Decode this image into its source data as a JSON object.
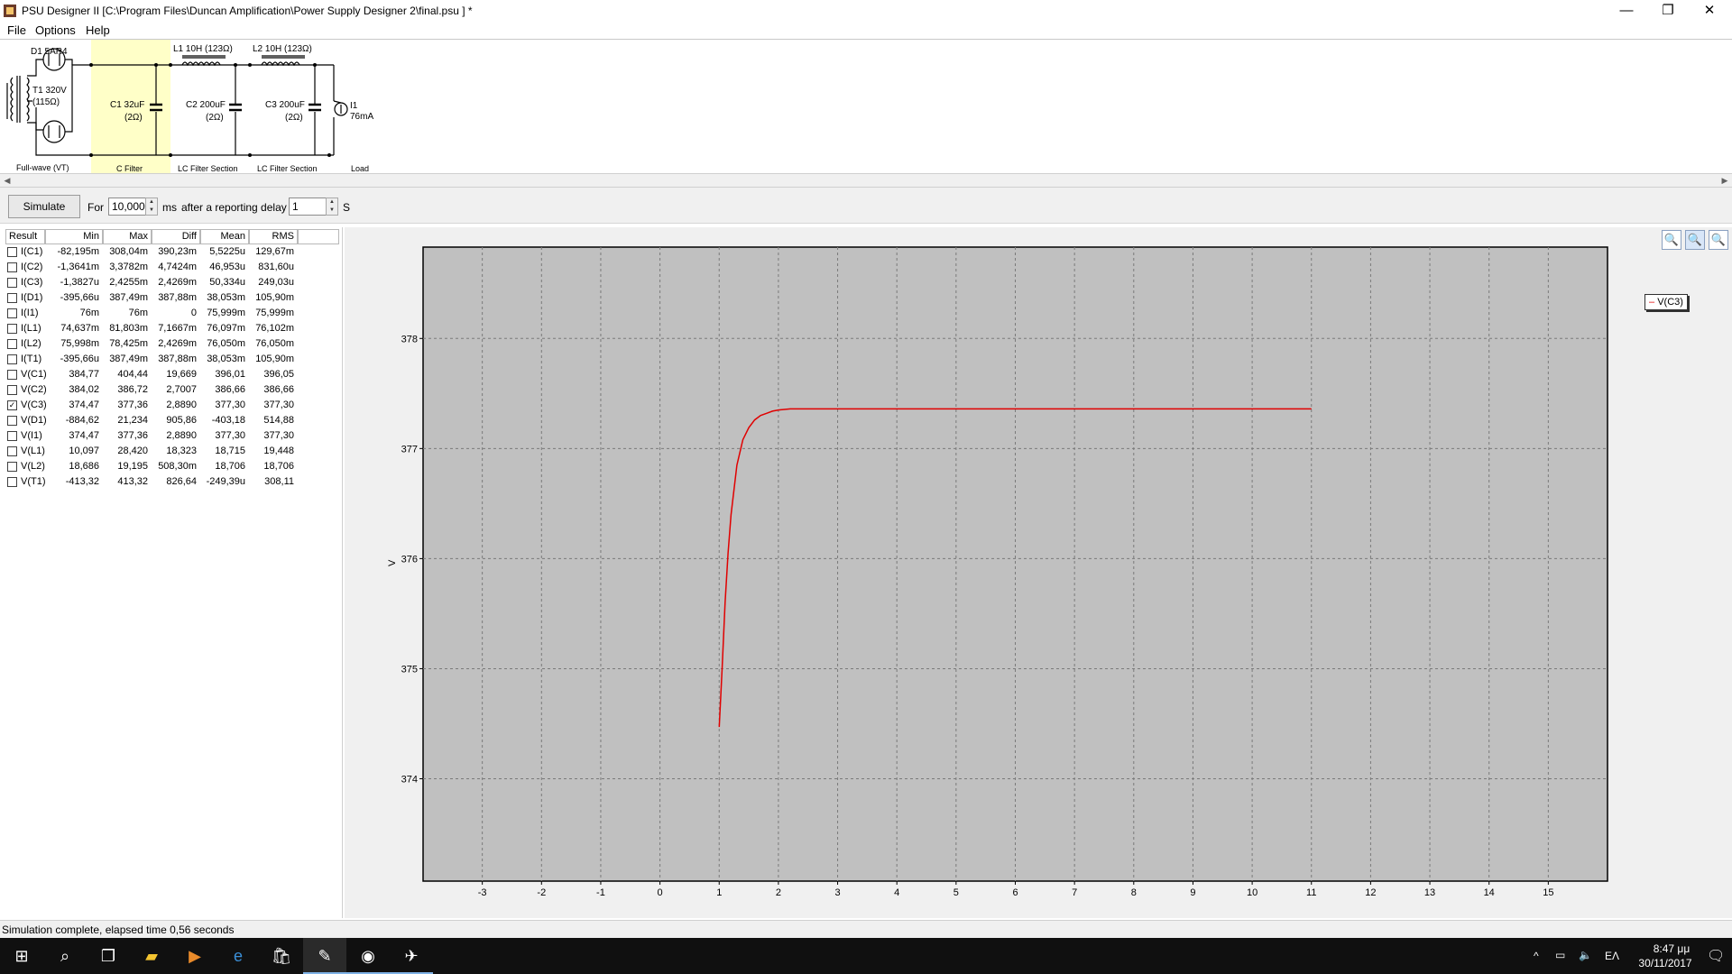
{
  "window": {
    "title": "PSU Designer II  [C:\\Program Files\\Duncan Amplification\\Power Supply Designer 2\\final.psu ] *",
    "minimize": "—",
    "maximize": "❐",
    "close": "✕"
  },
  "menu": [
    "File",
    "Options",
    "Help"
  ],
  "schematic": {
    "d1": "D1 5AR4",
    "t1": "T1 320V",
    "t1_r": "(115Ω)",
    "c1": "C1 32uF",
    "c1_r": "(2Ω)",
    "l1": "L1 10H (123Ω)",
    "c2": "C2 200uF",
    "c2_r": "(2Ω)",
    "l2": "L2 10H (123Ω)",
    "c3": "C3 200uF",
    "c3_r": "(2Ω)",
    "i1": "I1",
    "i1_val": "76mA",
    "sections": [
      "Full-wave (VT)",
      "C Filter",
      "LC Filter Section",
      "LC Filter Section",
      "Load"
    ]
  },
  "toolbar": {
    "simulate": "Simulate",
    "for_label": "For",
    "duration": "10,000",
    "ms_label": "ms",
    "delay_label": "after a reporting delay of",
    "delay": "1",
    "s_label": "S"
  },
  "results": {
    "headers": [
      "Result",
      "Min",
      "Max",
      "Diff",
      "Mean",
      "RMS"
    ],
    "rows": [
      {
        "name": "I(C1)",
        "checked": false,
        "min": "-82,195m",
        "max": "308,04m",
        "diff": "390,23m",
        "mean": "5,5225u",
        "rms": "129,67m"
      },
      {
        "name": "I(C2)",
        "checked": false,
        "min": "-1,3641m",
        "max": "3,3782m",
        "diff": "4,7424m",
        "mean": "46,953u",
        "rms": "831,60u"
      },
      {
        "name": "I(C3)",
        "checked": false,
        "min": "-1,3827u",
        "max": "2,4255m",
        "diff": "2,4269m",
        "mean": "50,334u",
        "rms": "249,03u"
      },
      {
        "name": "I(D1)",
        "checked": false,
        "min": "-395,66u",
        "max": "387,49m",
        "diff": "387,88m",
        "mean": "38,053m",
        "rms": "105,90m"
      },
      {
        "name": "I(I1)",
        "checked": false,
        "min": "76m",
        "max": "76m",
        "diff": "0",
        "mean": "75,999m",
        "rms": "75,999m"
      },
      {
        "name": "I(L1)",
        "checked": false,
        "min": "74,637m",
        "max": "81,803m",
        "diff": "7,1667m",
        "mean": "76,097m",
        "rms": "76,102m"
      },
      {
        "name": "I(L2)",
        "checked": false,
        "min": "75,998m",
        "max": "78,425m",
        "diff": "2,4269m",
        "mean": "76,050m",
        "rms": "76,050m"
      },
      {
        "name": "I(T1)",
        "checked": false,
        "min": "-395,66u",
        "max": "387,49m",
        "diff": "387,88m",
        "mean": "38,053m",
        "rms": "105,90m"
      },
      {
        "name": "V(C1)",
        "checked": false,
        "min": "384,77",
        "max": "404,44",
        "diff": "19,669",
        "mean": "396,01",
        "rms": "396,05"
      },
      {
        "name": "V(C2)",
        "checked": false,
        "min": "384,02",
        "max": "386,72",
        "diff": "2,7007",
        "mean": "386,66",
        "rms": "386,66"
      },
      {
        "name": "V(C3)",
        "checked": true,
        "min": "374,47",
        "max": "377,36",
        "diff": "2,8890",
        "mean": "377,30",
        "rms": "377,30"
      },
      {
        "name": "V(D1)",
        "checked": false,
        "min": "-884,62",
        "max": "21,234",
        "diff": "905,86",
        "mean": "-403,18",
        "rms": "514,88"
      },
      {
        "name": "V(I1)",
        "checked": false,
        "min": "374,47",
        "max": "377,36",
        "diff": "2,8890",
        "mean": "377,30",
        "rms": "377,30"
      },
      {
        "name": "V(L1)",
        "checked": false,
        "min": "10,097",
        "max": "28,420",
        "diff": "18,323",
        "mean": "18,715",
        "rms": "19,448"
      },
      {
        "name": "V(L2)",
        "checked": false,
        "min": "18,686",
        "max": "19,195",
        "diff": "508,30m",
        "mean": "18,706",
        "rms": "18,706"
      },
      {
        "name": "V(T1)",
        "checked": false,
        "min": "-413,32",
        "max": "413,32",
        "diff": "826,64",
        "mean": "-249,39u",
        "rms": "308,11"
      }
    ]
  },
  "chart_data": {
    "type": "line",
    "ylabel": "V",
    "xlim": [
      -4,
      16
    ],
    "ylim": [
      373.07,
      378.83
    ],
    "xticks": [
      -3,
      -2,
      -1,
      0,
      1,
      2,
      3,
      4,
      5,
      6,
      7,
      8,
      9,
      10,
      11,
      12,
      13,
      14,
      15
    ],
    "yticks": [
      374,
      375,
      376,
      377,
      378
    ],
    "grid": true,
    "legend_position": "top-right",
    "series": [
      {
        "name": "V(C3)",
        "color": "#e00000",
        "x": [
          1.0,
          1.05,
          1.1,
          1.15,
          1.2,
          1.3,
          1.4,
          1.5,
          1.6,
          1.7,
          1.8,
          1.9,
          2.0,
          2.2,
          2.5,
          3.0,
          4.0,
          6.0,
          8.0,
          10.0,
          11.0
        ],
        "y": [
          374.47,
          375.0,
          375.6,
          376.05,
          376.4,
          376.85,
          377.08,
          377.19,
          377.26,
          377.3,
          377.32,
          377.34,
          377.35,
          377.36,
          377.36,
          377.36,
          377.36,
          377.36,
          377.36,
          377.36,
          377.36
        ]
      }
    ]
  },
  "chart_tools": [
    "zoom-in-icon",
    "zoom-fit-icon",
    "zoom-out-icon"
  ],
  "status": "Simulation complete, elapsed time 0,56 seconds",
  "taskbar": {
    "lang": "ΕΛ",
    "time": "8:47 μμ",
    "date": "30/11/2017"
  }
}
